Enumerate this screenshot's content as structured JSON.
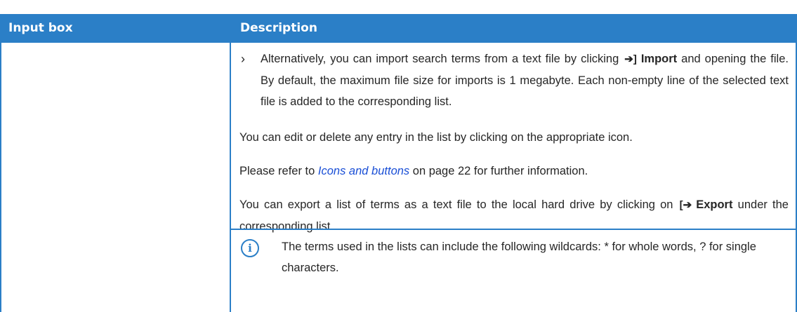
{
  "table": {
    "headers": [
      "Input box",
      "Description"
    ]
  },
  "bullet": {
    "chevron": "›",
    "text_before": "Alternatively, you can import search terms from a text file by clicking",
    "icon": "import-icon",
    "button_label": "Import",
    "text_after": "and opening the file. By default, the maximum file size for imports is 1 megabyte. Each non-empty line of the selected text file is added to the corresponding list."
  },
  "para1": "You can edit or delete any entry in the list by clicking on the appropriate icon.",
  "para2": {
    "before": "Please refer to",
    "link": "Icons and buttons",
    "after": "on page 22 for further information."
  },
  "para3": {
    "before": "You can export a list of terms as a text file to the local hard drive by clicking on",
    "icon": "export-icon",
    "button_label": "Export",
    "after": "under the corresponding list."
  },
  "note": {
    "icon": "info-icon",
    "symbol": "i",
    "text": "The terms used in the lists can include the following wildcards: * for whole words, ? for single characters."
  },
  "colors": {
    "accent": "#2b7fc7",
    "link": "#1a4fd6"
  }
}
